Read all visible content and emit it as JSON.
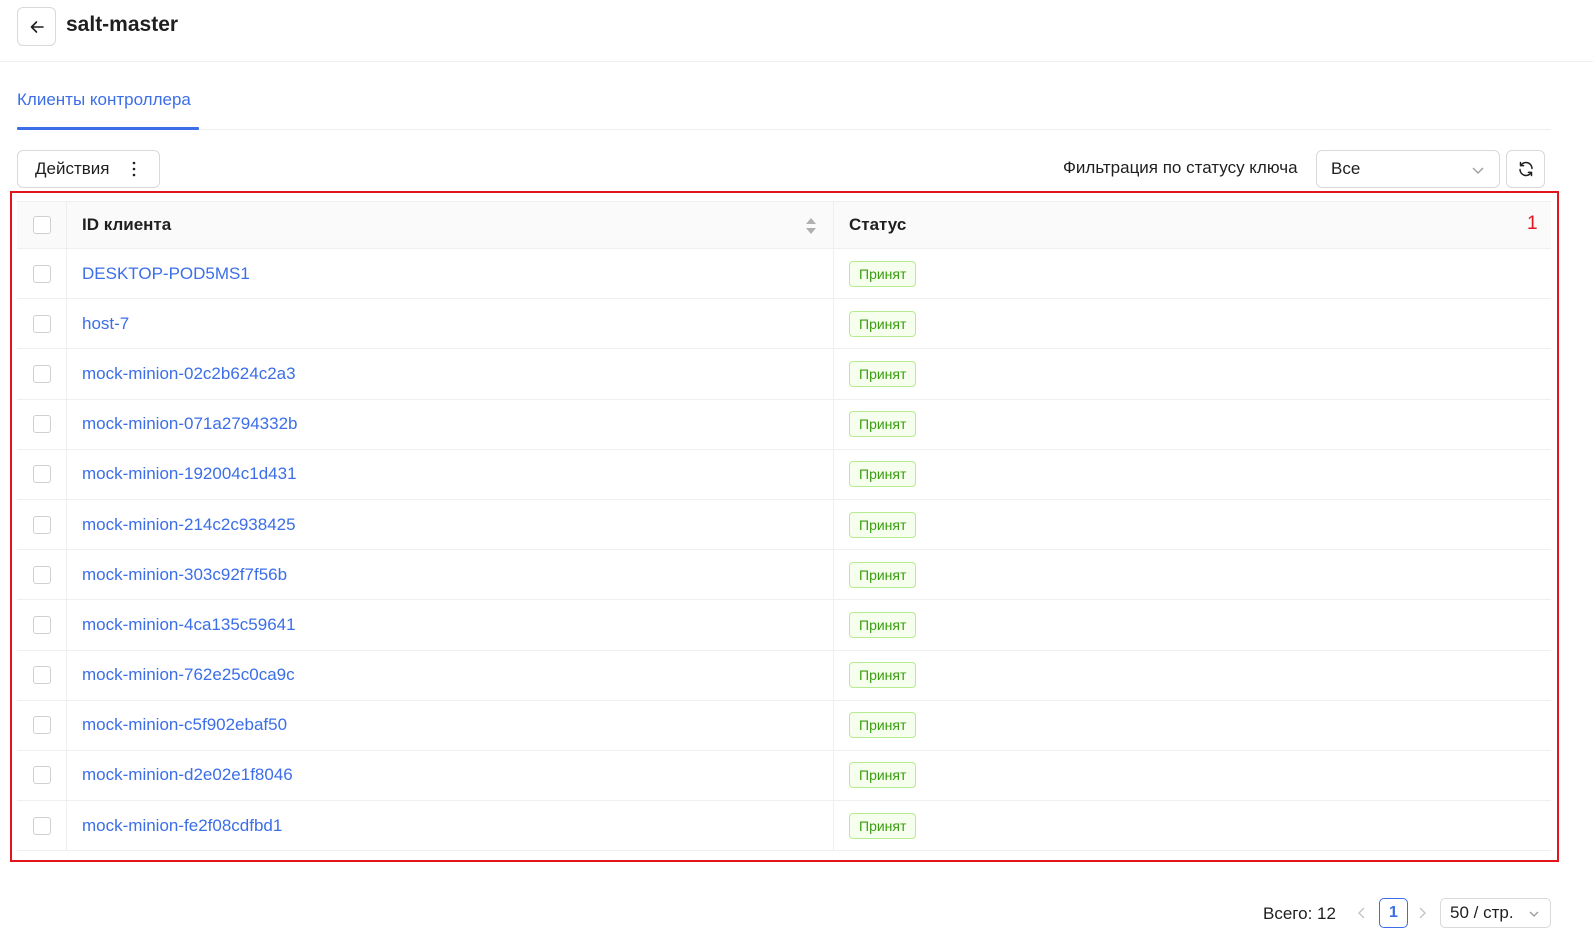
{
  "header": {
    "title": "salt-master"
  },
  "tabs": [
    {
      "label": "Клиенты контроллера",
      "active": true
    }
  ],
  "toolbar": {
    "actions_label": "Действия",
    "filter_label": "Фильтрация по статусу ключа",
    "filter_value": "Все"
  },
  "annotation": {
    "badge": "1",
    "color": "#e3151c"
  },
  "table": {
    "columns": [
      "ID клиента",
      "Статус"
    ],
    "rows": [
      {
        "id": "DESKTOP-POD5MS1",
        "status": "Принят"
      },
      {
        "id": "host-7",
        "status": "Принят"
      },
      {
        "id": "mock-minion-02c2b624c2a3",
        "status": "Принят"
      },
      {
        "id": "mock-minion-071a2794332b",
        "status": "Принят"
      },
      {
        "id": "mock-minion-192004c1d431",
        "status": "Принят"
      },
      {
        "id": "mock-minion-214c2c938425",
        "status": "Принят"
      },
      {
        "id": "mock-minion-303c92f7f56b",
        "status": "Принят"
      },
      {
        "id": "mock-minion-4ca135c59641",
        "status": "Принят"
      },
      {
        "id": "mock-minion-762e25c0ca9c",
        "status": "Принят"
      },
      {
        "id": "mock-minion-c5f902ebaf50",
        "status": "Принят"
      },
      {
        "id": "mock-minion-d2e02e1f8046",
        "status": "Принят"
      },
      {
        "id": "mock-minion-fe2f08cdfbd1",
        "status": "Принят"
      }
    ]
  },
  "pagination": {
    "total": "Всего: 12",
    "current_page": "1",
    "page_size": "50 / стр."
  },
  "colors": {
    "accent": "#3b6ee8",
    "status_green": "#389e0d"
  }
}
